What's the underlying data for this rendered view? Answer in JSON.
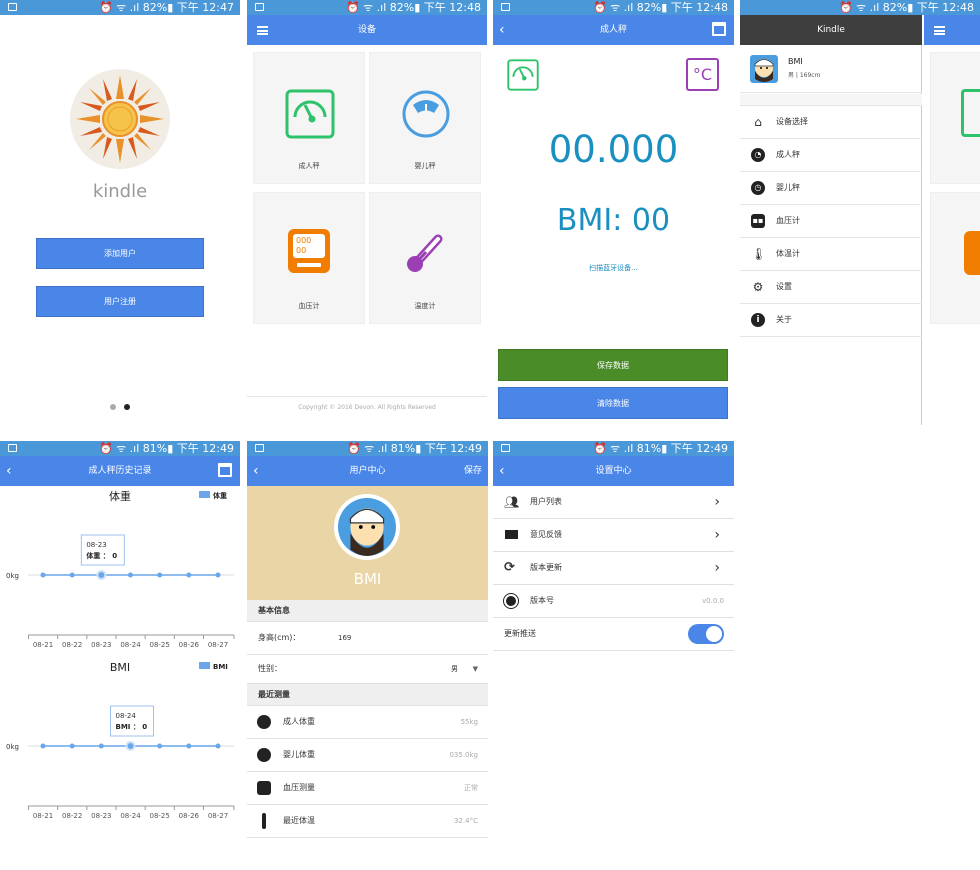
{
  "screens": {
    "s1": {
      "status": {
        "time": "下午 12:47",
        "battery": "82%"
      },
      "app_name": "kindle",
      "add_user": "添加用户",
      "register": "用户注册"
    },
    "s2": {
      "status": {
        "time": "下午 12:48",
        "battery": "82%"
      },
      "title": "设备",
      "tiles": [
        "成人秤",
        "婴儿秤",
        "血压计",
        "温度计"
      ],
      "copyright": "Copyright © 2016 Devon. All Rights Reserved",
      "bp_display": {
        "top": "000",
        "bottom": "00"
      }
    },
    "s3": {
      "status": {
        "time": "下午 12:48",
        "battery": "82%"
      },
      "title": "成人秤",
      "weight": "00.000",
      "bmi": "BMI: 00",
      "scan": "扫描蓝牙设备...",
      "unit": "°C",
      "save": "保存数据",
      "clear": "清除数据"
    },
    "s4": {
      "status": {
        "time": "下午 12:48",
        "battery": "82%"
      },
      "title": "Kindle",
      "user_name": "BMI",
      "user_info": "男 | 169cm",
      "menu": [
        "设备选择",
        "成人秤",
        "婴儿秤",
        "血压计",
        "体温计",
        "设置",
        "关于"
      ]
    },
    "s5": {
      "status": {
        "time": "下午 12:49",
        "battery": "81%"
      },
      "title": "成人秤历史记录",
      "chart1_title": "体重",
      "chart1_legend": "体重",
      "chart1_yaxis": "0kg",
      "chart1_tip_date": "08-23",
      "chart1_tip_value": "体重 ： 0",
      "chart2_title": "BMI",
      "chart2_legend": "BMI",
      "chart2_yaxis": "0kg",
      "chart2_tip_date": "08-24",
      "chart2_tip_value": "BMI ： 0"
    },
    "s6": {
      "status": {
        "time": "下午 12:49",
        "battery": "81%"
      },
      "title": "用户中心",
      "save": "保存",
      "avatar_label": "BMI",
      "section1": "基本信息",
      "height_label": "身高(cm)：",
      "height_value": "169",
      "gender_label": "性别：",
      "gender_value": "男",
      "section2": "最近测量",
      "rows": [
        {
          "label": "成人体重",
          "value": "55kg"
        },
        {
          "label": "婴儿体重",
          "value": "035.0kg"
        },
        {
          "label": "血压测量",
          "value": "正常"
        },
        {
          "label": "最近体温",
          "value": "32.4°C"
        }
      ]
    },
    "s7": {
      "status": {
        "time": "下午 12:49",
        "battery": "81%"
      },
      "title": "设置中心",
      "rows": [
        "用户列表",
        "意见反馈",
        "版本更新",
        "版本号",
        "更新推送"
      ],
      "version": "v0.0.0"
    }
  },
  "chart_data": [
    {
      "type": "line",
      "title": "体重",
      "categories": [
        "08-21",
        "08-22",
        "08-23",
        "08-24",
        "08-25",
        "08-26",
        "08-27"
      ],
      "series": [
        {
          "name": "体重",
          "values": [
            0,
            0,
            0,
            0,
            0,
            0,
            0
          ]
        }
      ],
      "ylabel": "0kg",
      "color": "#6aa6e8"
    },
    {
      "type": "line",
      "title": "BMI",
      "categories": [
        "08-21",
        "08-22",
        "08-23",
        "08-24",
        "08-25",
        "08-26",
        "08-27"
      ],
      "series": [
        {
          "name": "BMI",
          "values": [
            0,
            0,
            0,
            0,
            0,
            0,
            0
          ]
        }
      ],
      "ylabel": "0kg",
      "color": "#6aa6e8"
    }
  ],
  "colors": {
    "primary": "#4a86e8",
    "status": "#4a98d8",
    "green": "#4a8c28",
    "teal": "#1a8fc0",
    "orange": "#f07d00",
    "purple": "#9b3fb5",
    "scale_green": "#2ec26a"
  }
}
